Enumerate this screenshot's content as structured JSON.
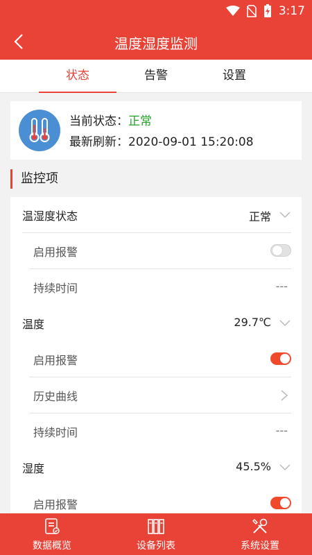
{
  "status_bar": {
    "time": "3:17"
  },
  "header": {
    "title": "温度湿度监测"
  },
  "tabs": [
    {
      "label": "状态",
      "active": true
    },
    {
      "label": "告警",
      "active": false
    },
    {
      "label": "设置",
      "active": false
    }
  ],
  "status_card": {
    "state_label": "当前状态：",
    "state_value": "正常",
    "refresh_label": "最新刷新：",
    "refresh_value": "2020-09-01 15:20:08"
  },
  "section": {
    "title": "监控项"
  },
  "items": [
    {
      "label": "温湿度状态",
      "value": "正常",
      "type": "parent"
    },
    {
      "label": "启用报警",
      "type": "toggle",
      "enabled": false
    },
    {
      "label": "持续时间",
      "value": "---",
      "type": "dash"
    },
    {
      "label": "温度",
      "value": "29.7℃",
      "type": "parent"
    },
    {
      "label": "启用报警",
      "type": "toggle",
      "enabled": true
    },
    {
      "label": "历史曲线",
      "type": "link"
    },
    {
      "label": "持续时间",
      "value": "---",
      "type": "dash"
    },
    {
      "label": "湿度",
      "value": "45.5%",
      "type": "parent"
    },
    {
      "label": "启用报警",
      "type": "toggle",
      "enabled": true
    }
  ],
  "bottom_nav": [
    {
      "label": "数据概览",
      "icon": "data-overview-icon"
    },
    {
      "label": "设备列表",
      "icon": "device-list-icon"
    },
    {
      "label": "系统设置",
      "icon": "system-settings-icon"
    }
  ],
  "colors": {
    "brand": "#e94237",
    "ok": "#25a028",
    "toggle_on": "#ef4a2c",
    "icon_blue": "#4a8fd4"
  }
}
